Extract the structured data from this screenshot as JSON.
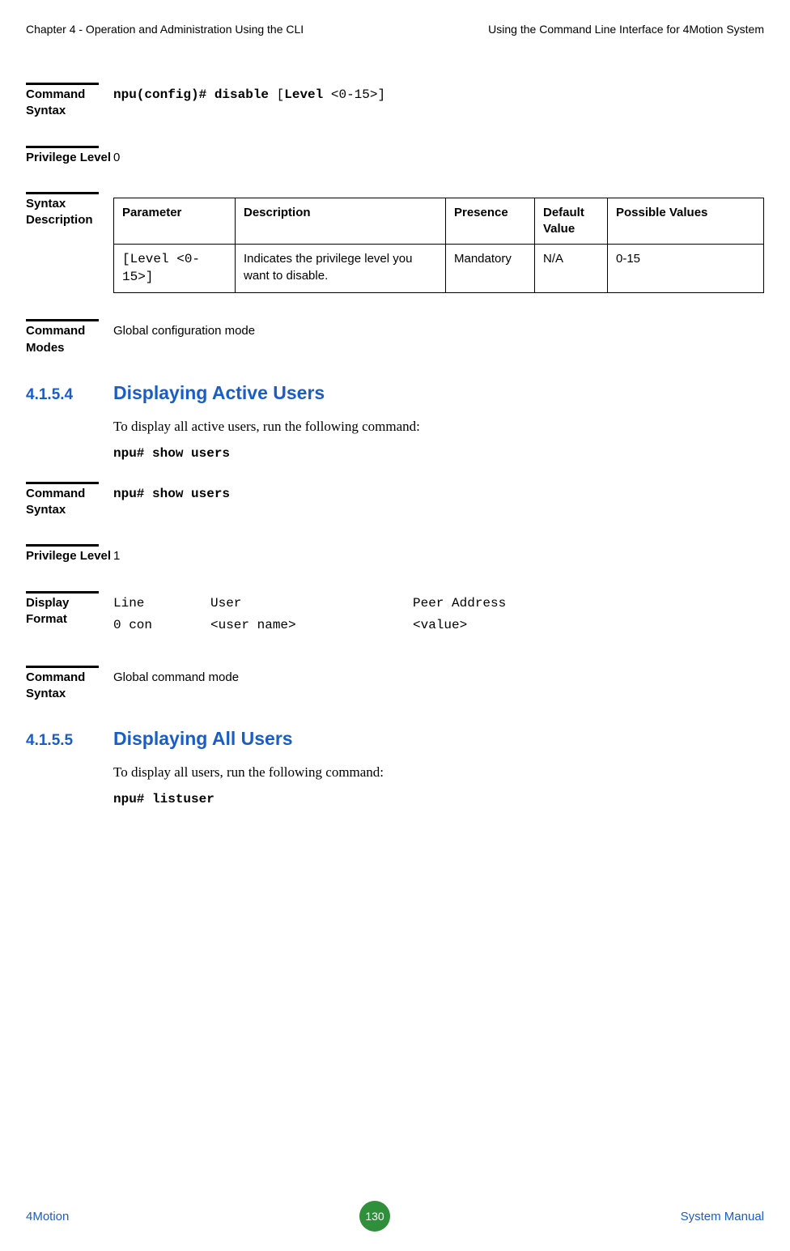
{
  "header": {
    "left": "Chapter 4 - Operation and Administration Using the CLI",
    "right": "Using the Command Line Interface for 4Motion System"
  },
  "block1": {
    "label": "Command Syntax",
    "cmd_bold1": "npu(config)# disable ",
    "cmd_plain1": "[",
    "cmd_bold2": "Level ",
    "cmd_plain2": "<0-15>]"
  },
  "block2": {
    "label": "Privilege Level",
    "value": "0"
  },
  "block3": {
    "label": "Syntax Description",
    "table": {
      "headers": {
        "param": "Parameter",
        "desc": "Description",
        "presence": "Presence",
        "default": "Default Value",
        "possible": "Possible Values"
      },
      "row": {
        "param": "[Level <0-15>]",
        "desc": "Indicates the privilege level you want to disable.",
        "presence": "Mandatory",
        "default": "N/A",
        "possible": "0-15"
      }
    }
  },
  "block4": {
    "label": "Command Modes",
    "value": "Global configuration mode"
  },
  "section1": {
    "num": "4.1.5.4",
    "title": "Displaying Active Users",
    "para": "To display all active users, run the following command:",
    "cmd": "npu# show users"
  },
  "block5": {
    "label": "Command Syntax",
    "cmd": "npu# show users"
  },
  "block6": {
    "label": "Privilege Level",
    "value": "1"
  },
  "block7": {
    "label": "Display Format",
    "row1": {
      "c1": "Line",
      "c2": "User",
      "c3": "Peer Address"
    },
    "row2": {
      "c1": "0 con",
      "c2": "<user name>",
      "c3": "<value>"
    }
  },
  "block8": {
    "label": "Command Syntax",
    "value": "Global command mode"
  },
  "section2": {
    "num": "4.1.5.5",
    "title": "Displaying All Users",
    "para": "To display all users, run the following command:",
    "cmd": "npu# listuser"
  },
  "footer": {
    "left": "4Motion",
    "page": "130",
    "right": "System Manual"
  }
}
